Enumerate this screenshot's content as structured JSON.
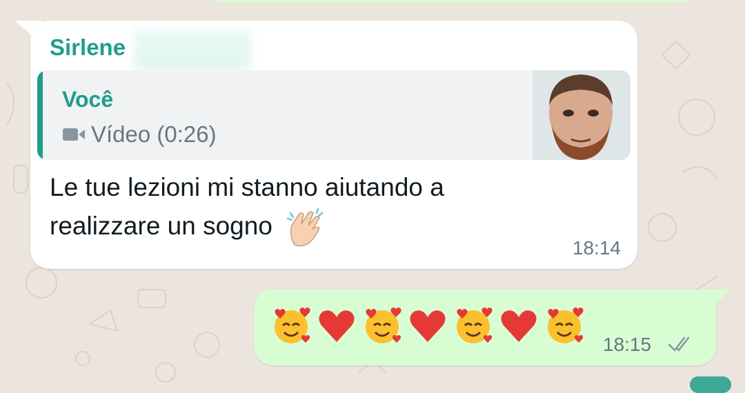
{
  "incoming": {
    "sender": "Sirlene",
    "reply": {
      "author": "Você",
      "media_label": "Vídeo (0:26)"
    },
    "text_line1": "Le tue lezioni mi stanno aiutando a",
    "text_line2": "realizzare un sogno",
    "emoji": "clapping-hands",
    "time": "18:14"
  },
  "outgoing": {
    "emojis": [
      "smiling-face-with-hearts",
      "red-heart",
      "smiling-face-with-hearts",
      "red-heart",
      "smiling-face-with-hearts",
      "red-heart",
      "smiling-face-with-hearts"
    ],
    "time": "18:15",
    "status": "read"
  },
  "colors": {
    "accent": "#1f9e8a",
    "background": "#ece5dd",
    "incoming_bubble": "#ffffff",
    "outgoing_bubble": "#d9fdd3",
    "meta_text": "#667781"
  }
}
